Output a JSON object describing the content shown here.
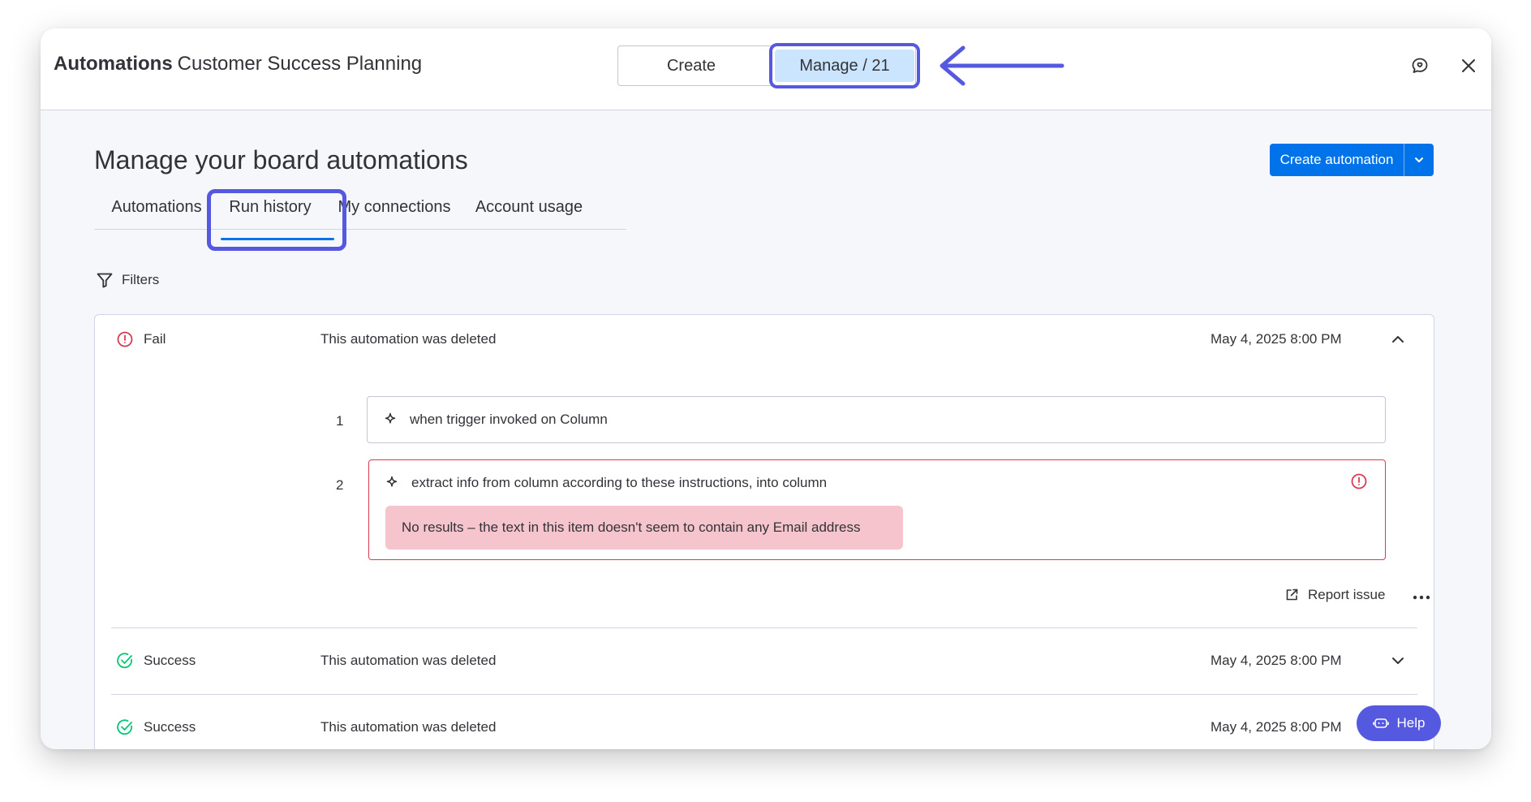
{
  "header": {
    "app_name": "Automations",
    "board_name": "Customer Success Planning",
    "tabs": [
      {
        "label": "Create"
      },
      {
        "label": "Manage / 21"
      }
    ]
  },
  "main": {
    "title": "Manage your board automations",
    "create_button_label": "Create automation",
    "tabs": [
      {
        "label": "Automations"
      },
      {
        "label": "Run history"
      },
      {
        "label": "My connections"
      },
      {
        "label": "Account usage"
      }
    ],
    "filters_label": "Filters"
  },
  "runs": [
    {
      "status": "Fail",
      "description": "This automation was deleted",
      "date": "May 4, 2025 8:00 PM",
      "expanded": true,
      "steps": [
        {
          "number": "1",
          "text": "when trigger invoked on Column"
        },
        {
          "number": "2",
          "text": "extract info from column according to these instructions, into column",
          "error": "No results – the text in this item doesn't seem to contain any Email address"
        }
      ],
      "report_label": "Report issue"
    },
    {
      "status": "Success",
      "description": "This automation was deleted",
      "date": "May 4, 2025 8:00 PM"
    },
    {
      "status": "Success",
      "description": "This automation was deleted",
      "date": "May 4, 2025 8:00 PM"
    }
  ],
  "help_label": "Help",
  "colors": {
    "accent": "#5559df",
    "primary": "#0073ea",
    "fail": "#d83a52",
    "success": "#00c875",
    "selected_tab": "#cce5ff",
    "error_bg": "#f5c4cc"
  },
  "icons": [
    "feedback-icon",
    "close-icon",
    "chevron-down-icon",
    "filter-icon",
    "fail-icon",
    "success-icon",
    "chevron-up-icon",
    "sparkle-icon",
    "error-icon",
    "external-link-icon",
    "more-icon",
    "help-robot-icon",
    "arrow-icon"
  ]
}
